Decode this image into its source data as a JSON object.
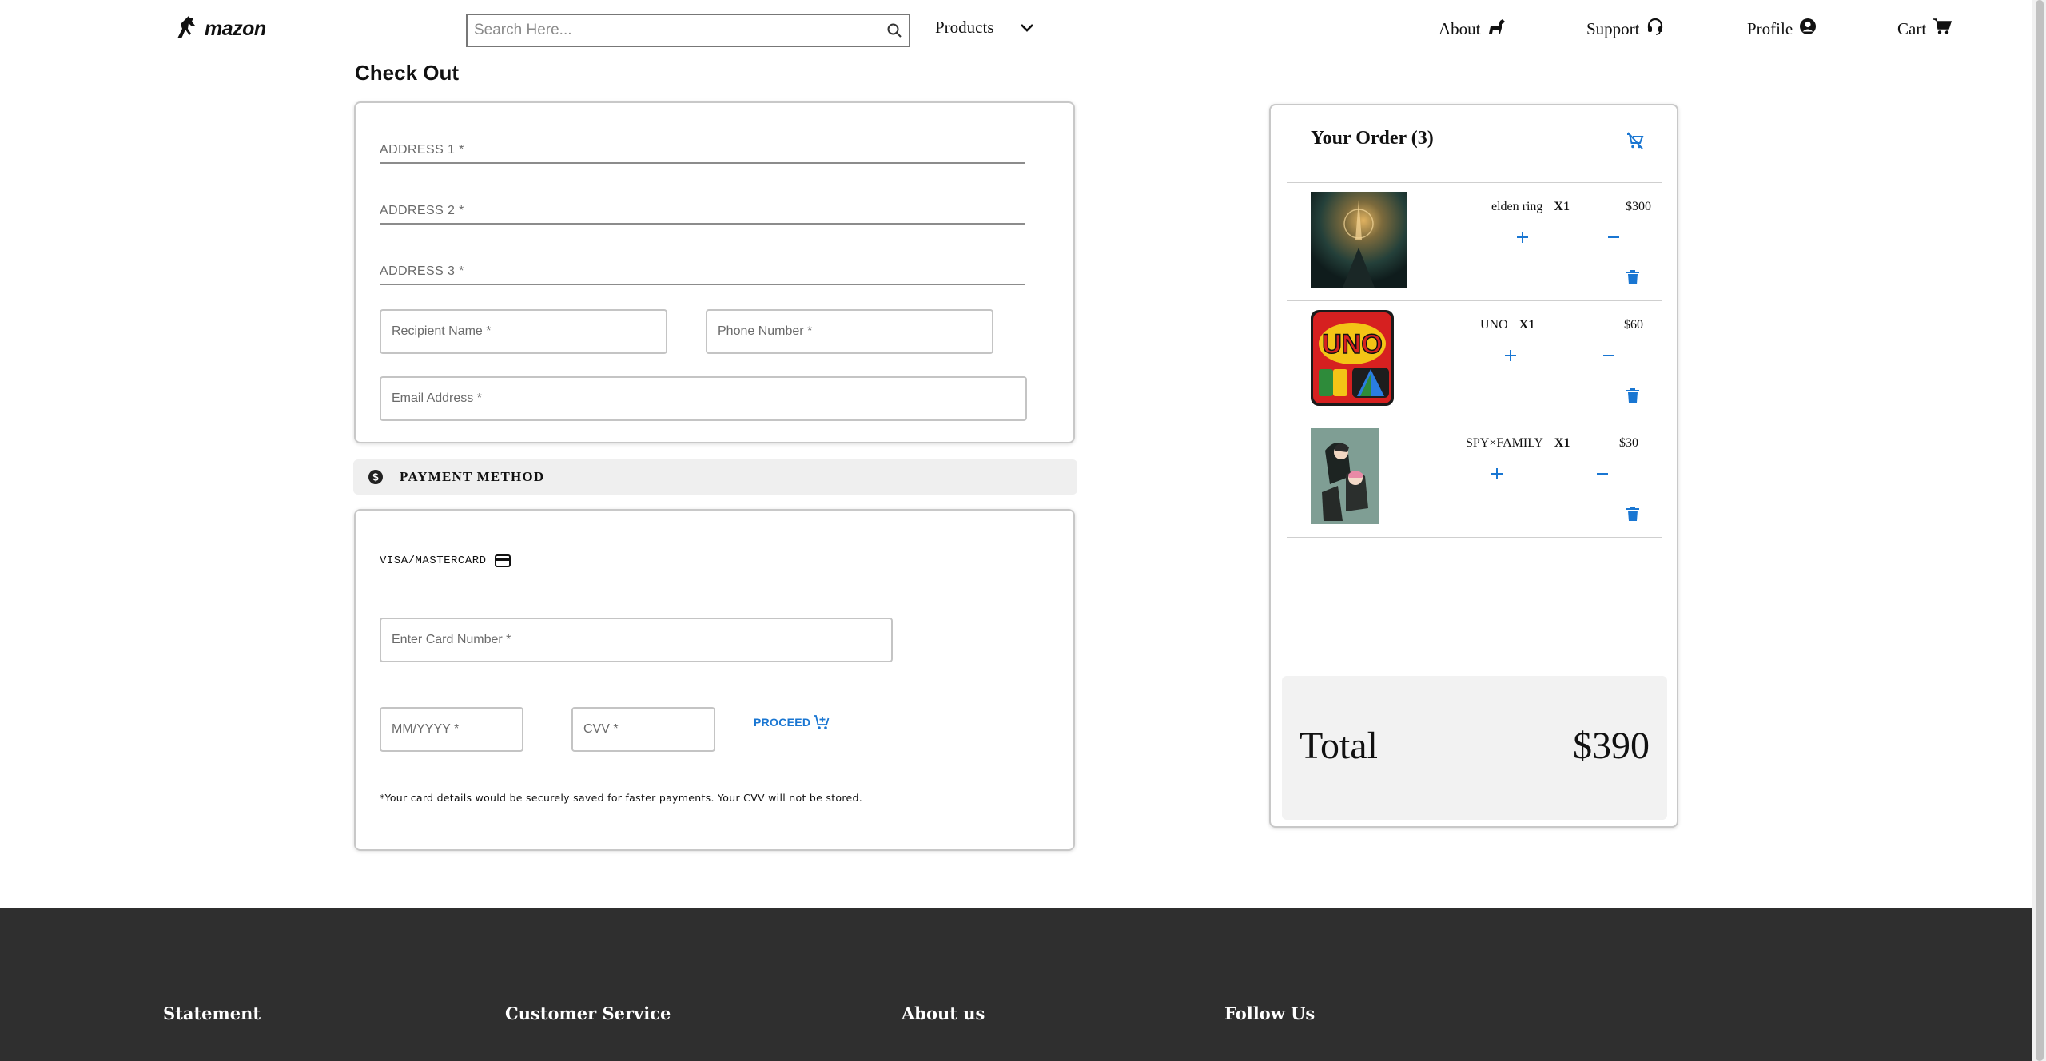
{
  "header": {
    "logo_text": "mazon",
    "search": {
      "placeholder": "Search Here..."
    },
    "nav": {
      "products": "Products",
      "about": "About",
      "support": "Support",
      "profile": "Profile",
      "cart": "Cart"
    }
  },
  "checkout": {
    "title": "Check Out",
    "address": {
      "address1": "ADDRESS 1 *",
      "address2": "ADDRESS 2 *",
      "address3": "ADDRESS 3 *",
      "recipient": "Recipient Name *",
      "phone": "Phone Number *",
      "email": "Email Address *"
    },
    "payment": {
      "section_label": "PAYMENT METHOD",
      "card_type": "VISA/MASTERCARD",
      "card_number": "Enter Card Number *",
      "expiry": "MM/YYYY *",
      "cvv": "CVV *",
      "proceed": "PROCEED",
      "note": "*Your card details would be securely saved for faster payments. Your CVV will not be stored."
    }
  },
  "order": {
    "title": "Your Order (3)",
    "items": [
      {
        "name": "elden ring",
        "qty": "X1",
        "price": "$300"
      },
      {
        "name": "UNO",
        "qty": "X1",
        "price": "$60"
      },
      {
        "name": "SPY×FAMILY",
        "qty": "X1",
        "price": "$30"
      }
    ],
    "total_label": "Total",
    "total_value": "$390"
  },
  "footer": {
    "columns": [
      "Statement",
      "Customer Service",
      "About us",
      "Follow Us"
    ]
  },
  "colors": {
    "accent": "#1976d2",
    "footer_bg": "#2f2f2f",
    "panel_bg": "#f2f2f2"
  },
  "icons": {
    "search": "search-icon",
    "products_toggle": "chevron-down-icon",
    "about": "horse-icon",
    "support": "headset-icon",
    "profile": "user-circle-icon",
    "cart": "cart-icon",
    "payment": "dollar-icon",
    "card": "credit-card-icon",
    "proceed": "cart-plus-icon",
    "order_cart": "cart-off-icon",
    "increase": "plus-icon",
    "decrease": "minus-icon",
    "remove": "trash-icon"
  }
}
